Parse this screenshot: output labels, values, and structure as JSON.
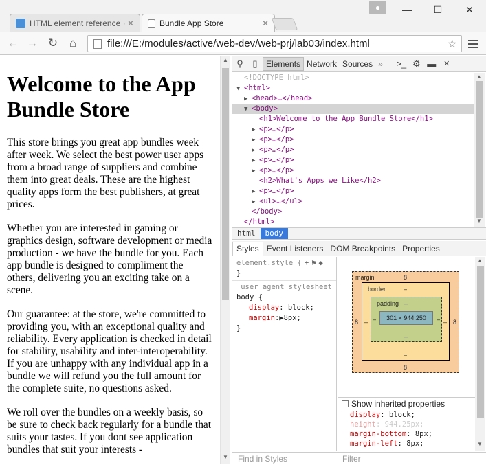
{
  "browser": {
    "tabs": [
      {
        "title": "HTML element reference ·",
        "active": false
      },
      {
        "title": "Bundle App Store",
        "active": true
      }
    ],
    "url": "file:///E:/modules/active/web-dev/web-prj/lab03/index.html",
    "window_buttons": {
      "minimize": "—",
      "maximize": "☐",
      "close": "✕"
    },
    "icons": {
      "back": "back-arrow-icon",
      "forward": "forward-arrow-icon",
      "reload": "reload-icon",
      "home": "home-icon",
      "star": "star-icon",
      "menu": "hamburger-menu-icon",
      "user": "user-icon"
    }
  },
  "page": {
    "heading": "Welcome to the App Bundle Store",
    "paragraphs": [
      "This store brings you great app bundles week after week. We select the best power user apps from a broad range of suppliers and combine them into great deals. These are the highest quality apps form the best publishers, at great prices.",
      "Whether you are interested in gaming or graphics design, software development or media production - we have the bundle for you. Each app bundle is designed to compliment the others, delivering you an exciting take on a scene.",
      "Our guarantee: at the store, we're committed to providing you, with an exceptional quality and reliability. Every application is checked in detail for stability, usability and inter-interoperability. If you are unhappy with any individual app in a bundle we will refund you the full amount for the complete suite, no questions asked.",
      "We roll over the bundles on a weekly basis, so be sure to check back regularly for a bundle that suits your tastes. If you dont see application bundles that suit your interests -"
    ]
  },
  "devtools": {
    "tabs": [
      "Elements",
      "Network",
      "Sources",
      "»"
    ],
    "dom_lines": [
      {
        "indent": 0,
        "tri": "",
        "text": "<!DOCTYPE html>",
        "kind": "doctype"
      },
      {
        "indent": 0,
        "tri": "▼",
        "text": "<html>",
        "kind": "tag"
      },
      {
        "indent": 1,
        "tri": "▶",
        "text": "<head>…</head>",
        "kind": "tag"
      },
      {
        "indent": 1,
        "tri": "▼",
        "text": "<body>",
        "kind": "tag",
        "selected": true
      },
      {
        "indent": 2,
        "tri": "",
        "text": "<h1>Welcome to the App Bundle Store</h1>",
        "kind": "tag"
      },
      {
        "indent": 2,
        "tri": "▶",
        "text": "<p>…</p>",
        "kind": "tag"
      },
      {
        "indent": 2,
        "tri": "▶",
        "text": "<p>…</p>",
        "kind": "tag"
      },
      {
        "indent": 2,
        "tri": "▶",
        "text": "<p>…</p>",
        "kind": "tag"
      },
      {
        "indent": 2,
        "tri": "▶",
        "text": "<p>…</p>",
        "kind": "tag"
      },
      {
        "indent": 2,
        "tri": "▶",
        "text": "<p>…</p>",
        "kind": "tag"
      },
      {
        "indent": 2,
        "tri": "",
        "text": "<h2>What's Apps we Like</h2>",
        "kind": "tag"
      },
      {
        "indent": 2,
        "tri": "▶",
        "text": "<p>…</p>",
        "kind": "tag"
      },
      {
        "indent": 2,
        "tri": "▶",
        "text": "<ul>…</ul>",
        "kind": "tag"
      },
      {
        "indent": 1,
        "tri": "",
        "text": "</body>",
        "kind": "tag"
      },
      {
        "indent": 0,
        "tri": "",
        "text": "</html>",
        "kind": "tag"
      }
    ],
    "breadcrumbs": [
      "html",
      "body"
    ],
    "subtabs": [
      "Styles",
      "Event Listeners",
      "DOM Breakpoints",
      "Properties"
    ],
    "styles": {
      "element_style": "element.style {",
      "element_close": "}",
      "ua_label": "user agent stylesheet",
      "selector": "body {",
      "props": [
        {
          "name": "display",
          "value": "block;"
        },
        {
          "name": "margin",
          "value": "▶8px;"
        }
      ],
      "close": "}"
    },
    "metrics": {
      "margin_label": "margin",
      "margin_top": "8",
      "margin_left": "8",
      "margin_right": "8",
      "margin_bottom": "8",
      "border_label": "border",
      "border_top": "–",
      "border_left": "–",
      "border_right": "–",
      "border_bottom": "–",
      "padding_label": "padding",
      "padding_top": "–",
      "padding_left": "–",
      "padding_right": "–",
      "padding_bottom": "–",
      "content": "301 × 944.250"
    },
    "computed": {
      "show_inherited": "Show inherited properties",
      "props": [
        {
          "name": "display",
          "value": "block;",
          "grey": false
        },
        {
          "name": "height",
          "value": "944.25px;",
          "grey": true
        },
        {
          "name": "margin-bottom",
          "value": "8px;",
          "grey": false
        },
        {
          "name": "margin-left",
          "value": "8px;",
          "grey": false
        }
      ]
    },
    "find_placeholder": "Find in Styles",
    "filter_placeholder": "Filter"
  },
  "colors": {
    "tag": "#881280",
    "selected_crumb": "#3879d9",
    "margin_box": "#f9cc9d",
    "border_box": "#fddd9b",
    "padding_box": "#c3d08b",
    "content_box": "#8cb6c0"
  }
}
